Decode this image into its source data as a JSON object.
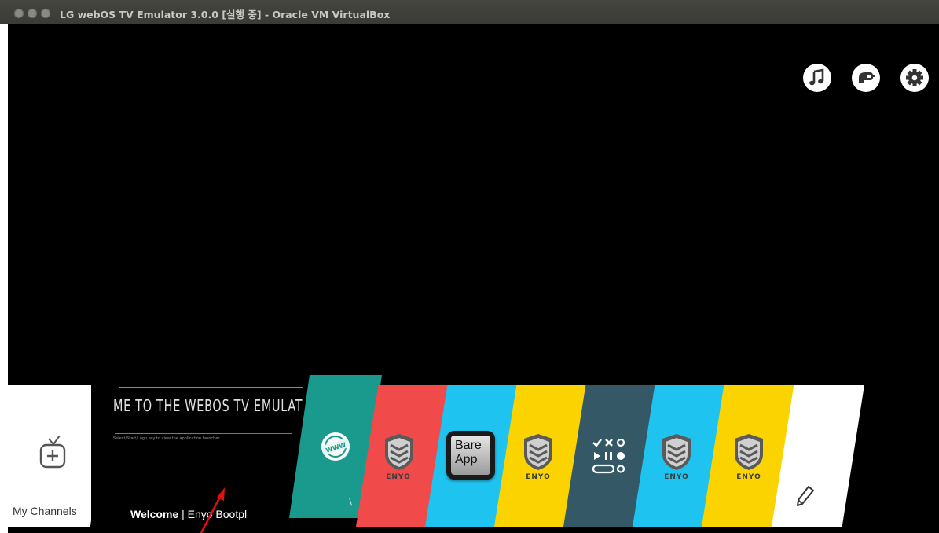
{
  "window": {
    "title": "LG webOS TV Emulator 3.0.0 [실행 중] - Oracle VM VirtualBox",
    "controls": [
      "close-icon",
      "minimize-icon",
      "maximize-icon"
    ]
  },
  "top_icons": [
    {
      "name": "music-icon"
    },
    {
      "name": "input-switch-icon"
    },
    {
      "name": "settings-gear-icon"
    }
  ],
  "launcher": {
    "my_channels_label": "My Channels",
    "welcome": {
      "heading": "ME TO THE WEBOS TV EMULATO",
      "small_text": "Select/Start/Logo key to view the application launcher.",
      "bottom_bold": "Welcome",
      "bottom_rest": " | Enyo Bootpl"
    },
    "teal_mark": "\\",
    "www_badge": "WWW",
    "bare_app": {
      "line1": "Bare",
      "line2": "App"
    },
    "enyo_label": "ENYO",
    "tile_colors": {
      "teal": "#1a9a8c",
      "red": "#f04a4a",
      "blue": "#1ec3ef",
      "yellow": "#fbd400",
      "slate": "#355866",
      "white": "#ffffff"
    }
  }
}
